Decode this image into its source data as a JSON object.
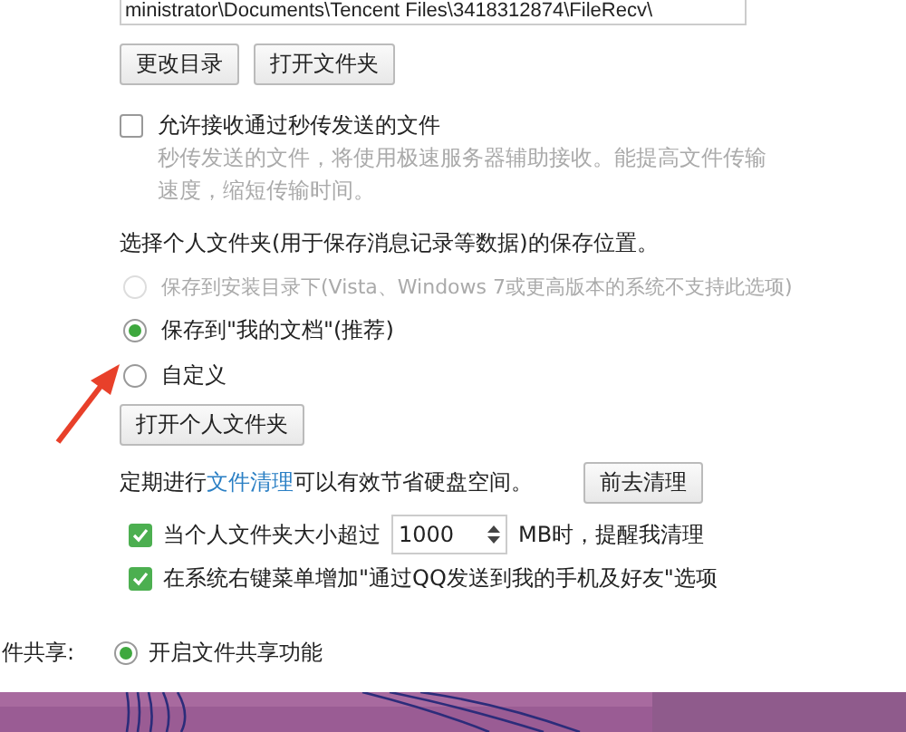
{
  "path_field": {
    "value": "ministrator\\Documents\\Tencent Files\\3418312874\\FileRecv\\"
  },
  "path_buttons": [
    "更改目录",
    "打开文件夹"
  ],
  "fast_transfer": {
    "label": "允许接收通过秒传发送的文件",
    "checked": false,
    "description": "秒传发送的文件，将使用极速服务器辅助接收。能提高文件传输速度，缩短传输时间。"
  },
  "folder_section": {
    "title": "选择个人文件夹(用于保存消息记录等数据)的保存位置。",
    "options": [
      {
        "label": "保存到安装目录下(Vista、Windows 7或更高版本的系统不支持此选项)",
        "selected": false,
        "disabled": true
      },
      {
        "label": "保存到\"我的文档\"(推荐)",
        "selected": true,
        "disabled": false
      },
      {
        "label": "自定义",
        "selected": false,
        "disabled": false
      }
    ],
    "open_button": "打开个人文件夹"
  },
  "cleanup": {
    "text_before": "定期进行",
    "link": "文件清理",
    "text_after": "可以有效节省硬盘空间。",
    "button": "前去清理"
  },
  "size_reminder": {
    "checked": true,
    "label_before": "当个人文件夹大小超过",
    "value": "1000",
    "label_after": "MB时，提醒我清理"
  },
  "context_menu": {
    "checked": true,
    "label": "在系统右键菜单增加\"通过QQ发送到我的手机及好友\"选项"
  },
  "file_sharing": {
    "label": "件共享:",
    "options": [
      {
        "label": "开启文件共享功能",
        "selected": true
      }
    ]
  }
}
